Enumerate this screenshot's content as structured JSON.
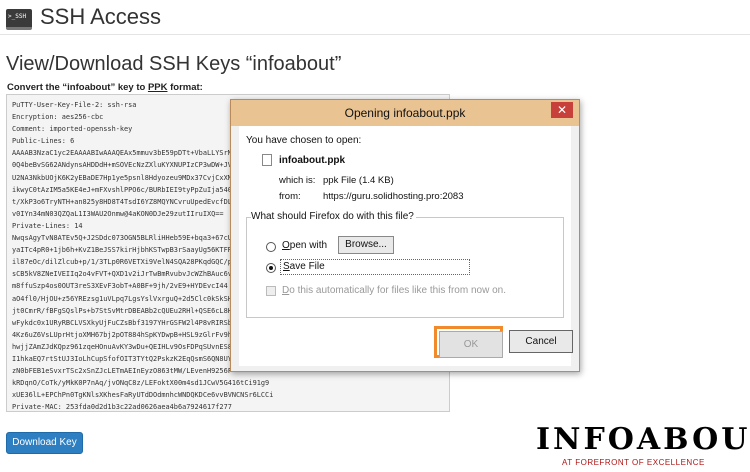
{
  "header": {
    "icon_text": ">_SSH",
    "title": "SSH Access"
  },
  "page": {
    "title": "View/Download SSH Keys “infoabout”",
    "convert_prefix": "Convert the “infoabout” key to ",
    "convert_format": "PPK",
    "convert_suffix": " format:"
  },
  "key_lines": [
    "PuTTY-User-Key-File-2: ssh-rsa",
    "Encryption: aes256-cbc",
    "Comment: imported-openssh-key",
    "Public-Lines: 6",
    "AAAAB3NzaC1yc2EAAAABIwAAAQEAx5mmuv3bE59pDTt+VbaLLYSrM",
    "0Q4beBvSG62ANdynsAHDDdH+mSOVEcNzZXluKYXNUPIzCP3wDW+JVI",
    "U2NA3NkbUOjK6K2yEBaDE7Hp1ye5psnl8Hdyozeu9MDx37CvjCxXMO",
    "ikwyC0tAzIM5a5KE4eJ+mFXvshlPPO6c/BURbIEI9tyPpZuIja540",
    "t/XkP3o6TryNTH+an825y8HD8T4TsdI6YZ8MQYNCvruUpedEvcfDL",
    "v0IYn34mN03QZQaL1I3WAU2Onmw@4aKON0DJe29zutIIruIXQ==",
    "Private-Lines: 14",
    "NwqsAgyTvN8ATEv5Q+J2SDdc073OGN5BLRliHHeb59E+bqa3+67cU",
    "yaITc4pR0+1jb6h+KvZ1BeJSS7kirHjbhKSTwpB3rSaayUg56KTFR",
    "il87eOc/dilZlcub+p/1/3TLp0R6VETXi9VelN4SQA28PKqdGQC/p",
    "sCB5kV8ZNeIVEIIq2o4vFVT+QXD1v2iJrTwBmRvubvJcWZhBAuc6v",
    "m8ffuSzp4os0OUT3reS3XEvF3obT+A0BF+9jh/2vE9+HYDEvcI44",
    "aO4fl0/HjOU+z56YREzsg1uVLpq7LgsYslVxrguQ+2d5Clc0kSkSH",
    "jt0CmrR/fBFgSQslPs+b7StSvMtrDBEABb2cQUEu2RHl+QSE6cL8H",
    "wFykdc0x1URyRBCLVSXkyUjFuCZsBbf3197YHrGSFW2l4P8vRIRSbX",
    "4Kz6uZ6VsLUprHtjoXMH67bj2pOT884hSpKYDwpB+HSL9zGlrFv9hR",
    "hwjjZAmZJdKQpz961zqeHOnuAvKY3wDu+QEIHLv9OsFDPqSUvnES8",
    "I1hkaEQ7rtStUJ3IoLhCupSfofOIT3TYtQ2PskzK2EqQsmS6QN8UYR",
    "zN0bFEB1eSvxrTSc2xSnZJcLETmAEInEyzO863tMW/LEvenH9256F",
    "kRDqnO/CoTk/yMkK0P7nAq/jvONqC8z/LEFoktX00m4sd1JCwV5G416tCi91g9",
    "xUE36lL+EPChPn0TgKNlsXKhesFaRyUTdDOdmnhcWNDQKDCe6vvBVNCNSr6LCCi",
    "Private-MAC: 253fda0d2d1b3c22ad0626aea4b6a7924617f277"
  ],
  "download_button": "Download Key",
  "logo": {
    "word": "INFOABOUT",
    "tagline": "AT FOREFRONT OF EXCELLENCE"
  },
  "dialog": {
    "title": "Opening infoabout.ppk",
    "close": "✕",
    "chosen_label": "You have chosen to open:",
    "file_name": "infoabout.ppk",
    "which_is_label": "which is:",
    "which_is_value": "ppk File (1.4 KB)",
    "from_label": "from:",
    "from_value": "https://guru.solidhosting.pro:2083",
    "question": "What should Firefox do with this file?",
    "open_with_first": "O",
    "open_with_rest": "pen with",
    "browse": "Browse...",
    "save_first": "S",
    "save_rest": "ave File",
    "save_selected": true,
    "auto_first": "D",
    "auto_rest": "o this automatically for files like this from now on.",
    "ok": "OK",
    "cancel": "Cancel"
  },
  "colors": {
    "accent_highlight": "#f08a2a",
    "download_button": "#2d7fc2",
    "dialog_titlebar": "#eac392"
  }
}
